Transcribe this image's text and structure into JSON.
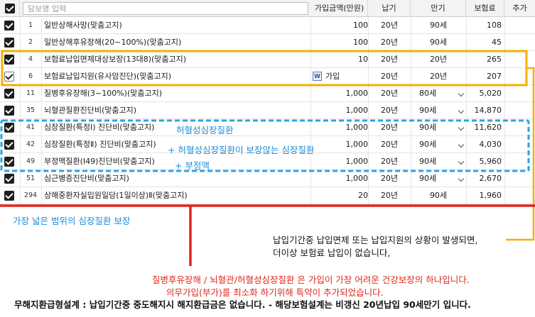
{
  "header": {
    "search_placeholder": "담보명 입력",
    "col_amount": "가입금액(만원)",
    "col_period": "납기",
    "col_maturity": "만기",
    "col_premium": "보험료",
    "col_add": "추가"
  },
  "rows": [
    {
      "no": "1",
      "name": "일반상해사망(맞춤고지)",
      "amount": "100",
      "period": "20년",
      "maturity": "90세",
      "premium": "108"
    },
    {
      "no": "2",
      "name": "일반상해후유장해(20~100%)(맞춤고지)",
      "amount": "100",
      "period": "20년",
      "maturity": "90세",
      "premium": "45"
    },
    {
      "no": "4",
      "name": "보험료납입면제대상보장(13대8)(맞춤고지)",
      "amount": "10",
      "period": "20년",
      "maturity": "20년",
      "premium": "265"
    },
    {
      "no": "6",
      "name": "보험료납입지원(유사암진단)(맞춤고지)",
      "amount": "가입",
      "period": "20년",
      "maturity": "20년",
      "premium": "207"
    },
    {
      "no": "11",
      "name": "질병후유장해(3~100%)(맞춤고지)",
      "amount": "1,000",
      "period": "20년",
      "maturity": "80세",
      "premium": "5,020"
    },
    {
      "no": "35",
      "name": "뇌혈관질환진단비(맞춤고지)",
      "amount": "1,000",
      "period": "20년",
      "maturity": "90세",
      "premium": "14,870"
    },
    {
      "no": "41",
      "name": "심장질환(특정Ⅰ) 진단비(맞춤고지)",
      "amount": "1,000",
      "period": "20년",
      "maturity": "90세",
      "premium": "11,620"
    },
    {
      "no": "42",
      "name": "심장질환(특정Ⅱ) 진단비(맞춤고지)",
      "amount": "1,000",
      "period": "20년",
      "maturity": "90세",
      "premium": "4,030"
    },
    {
      "no": "49",
      "name": "부정맥질환(Ⅰ49)진단비(맞춤고지)",
      "amount": "1,000",
      "period": "20년",
      "maturity": "90세",
      "premium": "5,960"
    },
    {
      "no": "51",
      "name": "심근병증진단비(맞춤고지)",
      "amount": "1,000",
      "period": "20년",
      "maturity": "90세",
      "premium": "2,670"
    },
    {
      "no": "294",
      "name": "상해중환자실입원일당(1일이상)Ⅱ(맞춤고지)",
      "amount": "20",
      "period": "20년",
      "maturity": "90세",
      "premium": "1,960"
    }
  ],
  "annotations": {
    "heart1": "허혈성심장질환",
    "heart2": "+ 허혈성심장질환이 보장않는 심장질환",
    "heart3": "+ 부정맥",
    "widest": "가장 넓은 범위의 심장질환 보장",
    "waiver1": "납입기간중 납입면제 또는 납입지원의 상황이 발생되면,",
    "waiver2": "더이상 보험료 납입이 없습니다,",
    "red1": "질병후유장해 / 뇌혈관/허혈성심장질환 은 가입이 가장 어려운 건강보장의 하나입니다.",
    "red2": "의무가입(부가)를 최소화 하기위해 특약이 추가되었습니다.",
    "bottom": "무해지환급형설계 : 납입기간중 중도해지시 해지환급금은 없습니다. - 해당보험설계는 비갱신 20년납입 90세만기 입니다."
  },
  "colors": {
    "highlight_box": "#f5b000",
    "dashed_box": "#2fa4dc",
    "red_line": "#e0261b",
    "blue_text": "#1f8bd6"
  }
}
